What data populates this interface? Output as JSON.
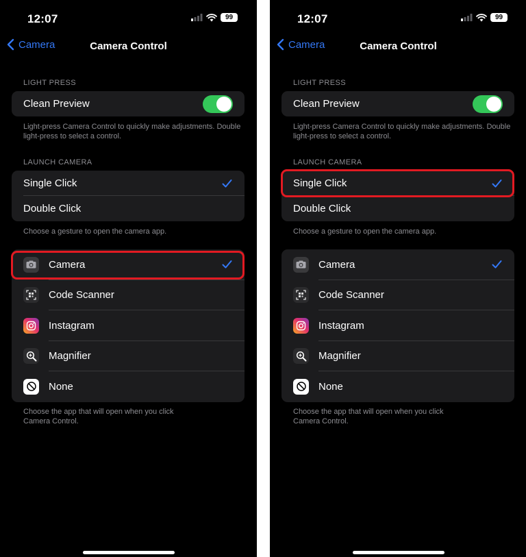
{
  "colors": {
    "accent": "#3478f6",
    "toggle_on": "#34c759",
    "highlight": "#e21a22",
    "group_bg": "#1c1c1e"
  },
  "status": {
    "time": "12:07",
    "battery": "99"
  },
  "nav": {
    "back_label": "Camera",
    "title": "Camera Control"
  },
  "light_press": {
    "header": "LIGHT PRESS",
    "clean_preview_label": "Clean Preview",
    "clean_preview_on": true,
    "footer": "Light-press Camera Control to quickly make adjustments. Double light-press to select a control."
  },
  "launch_camera": {
    "header": "LAUNCH CAMERA",
    "options": [
      "Single Click",
      "Double Click"
    ],
    "selected": "Single Click",
    "footer": "Choose a gesture to open the camera app."
  },
  "apps": {
    "items": [
      {
        "label": "Camera",
        "icon": "camera-icon",
        "selected": true
      },
      {
        "label": "Code Scanner",
        "icon": "qr-scanner-icon",
        "selected": false
      },
      {
        "label": "Instagram",
        "icon": "instagram-icon",
        "selected": false
      },
      {
        "label": "Magnifier",
        "icon": "magnifier-icon",
        "selected": false
      },
      {
        "label": "None",
        "icon": "none-icon",
        "selected": false
      }
    ],
    "footer": "Choose the app that will open when you click Camera Control."
  }
}
